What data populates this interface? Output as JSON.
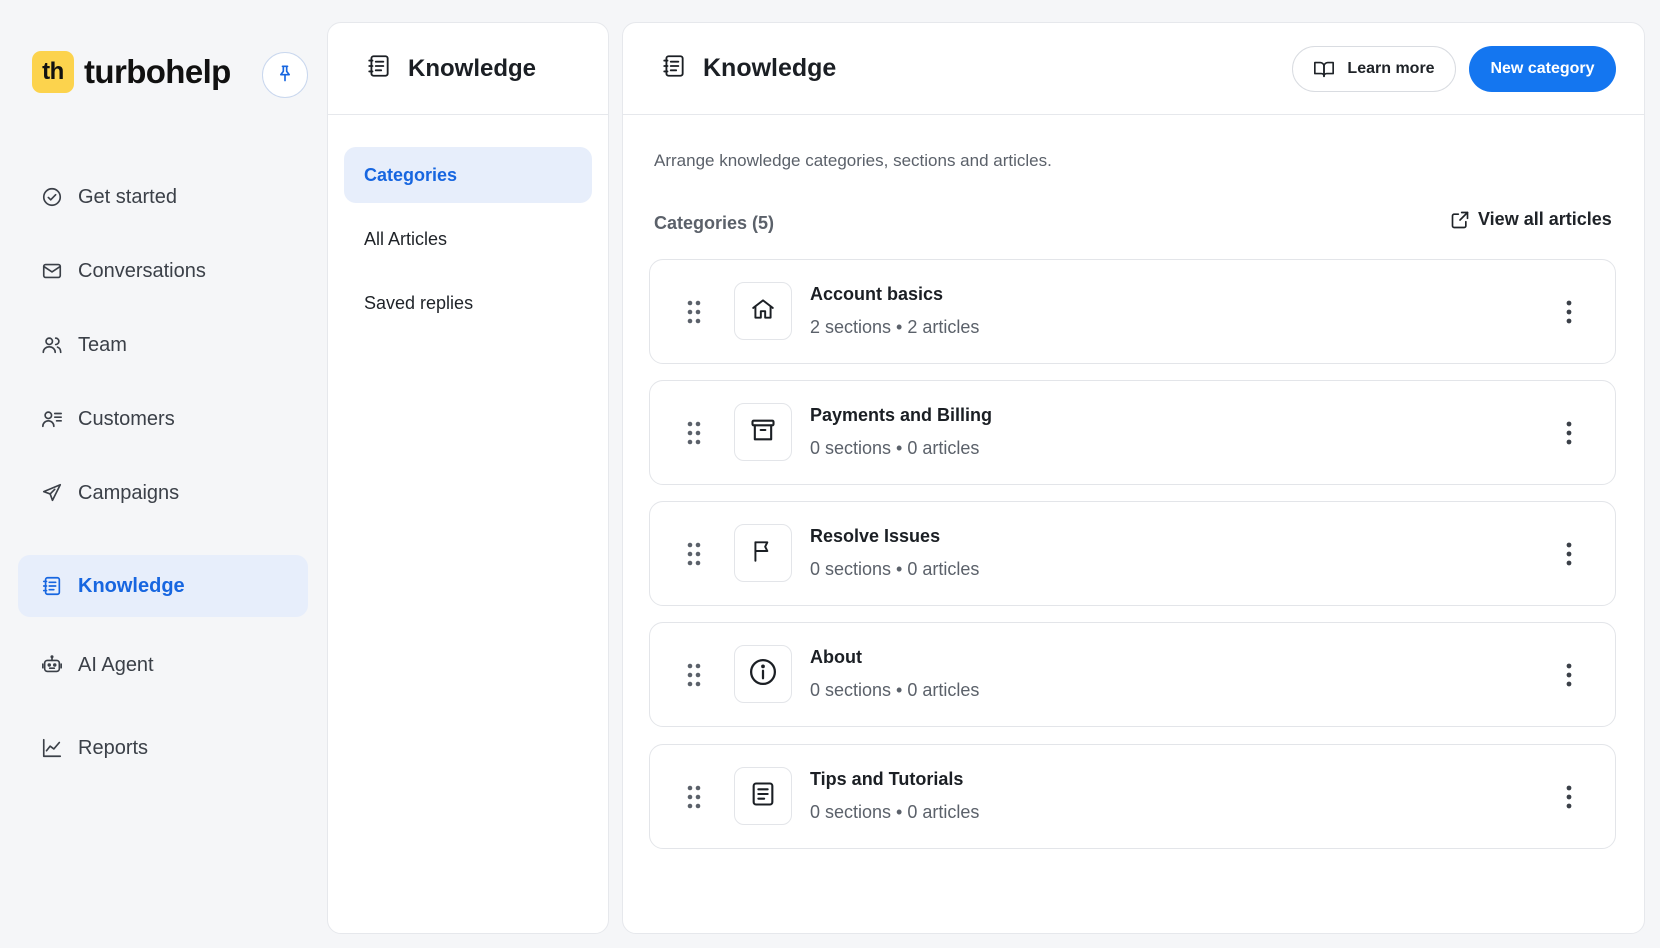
{
  "brand": {
    "logo_text": "th",
    "name": "turbohelp"
  },
  "colors": {
    "accent": "#1476f0",
    "active_bg": "#e7eefb",
    "logo_bg": "#fcd34d"
  },
  "sidebar": {
    "items": [
      {
        "label": "Get started",
        "icon": "check-circle-icon"
      },
      {
        "label": "Conversations",
        "icon": "mail-icon"
      },
      {
        "label": "Team",
        "icon": "users-icon"
      },
      {
        "label": "Customers",
        "icon": "contacts-icon"
      },
      {
        "label": "Campaigns",
        "icon": "send-icon"
      },
      {
        "label": "Knowledge",
        "icon": "notebook-icon",
        "active": true
      },
      {
        "label": "AI Agent",
        "icon": "robot-icon"
      },
      {
        "label": "Reports",
        "icon": "chart-line-icon"
      }
    ]
  },
  "knowledge_panel": {
    "title": "Knowledge",
    "items": [
      {
        "label": "Categories",
        "active": true
      },
      {
        "label": "All Articles"
      },
      {
        "label": "Saved replies"
      }
    ]
  },
  "main": {
    "title": "Knowledge",
    "learn_more_label": "Learn more",
    "new_category_label": "New category",
    "description": "Arrange knowledge categories, sections and articles.",
    "categories_count_label": "Categories (5)",
    "view_all_label": "View all articles",
    "categories": [
      {
        "title": "Account basics",
        "meta": "2 sections • 2 articles",
        "icon": "home-icon"
      },
      {
        "title": "Payments and Billing",
        "meta": "0 sections • 0 articles",
        "icon": "archive-icon"
      },
      {
        "title": "Resolve Issues",
        "meta": "0 sections • 0 articles",
        "icon": "flag-icon"
      },
      {
        "title": "About",
        "meta": "0 sections • 0 articles",
        "icon": "info-icon"
      },
      {
        "title": "Tips and Tutorials",
        "meta": "0 sections • 0 articles",
        "icon": "document-icon"
      }
    ]
  }
}
